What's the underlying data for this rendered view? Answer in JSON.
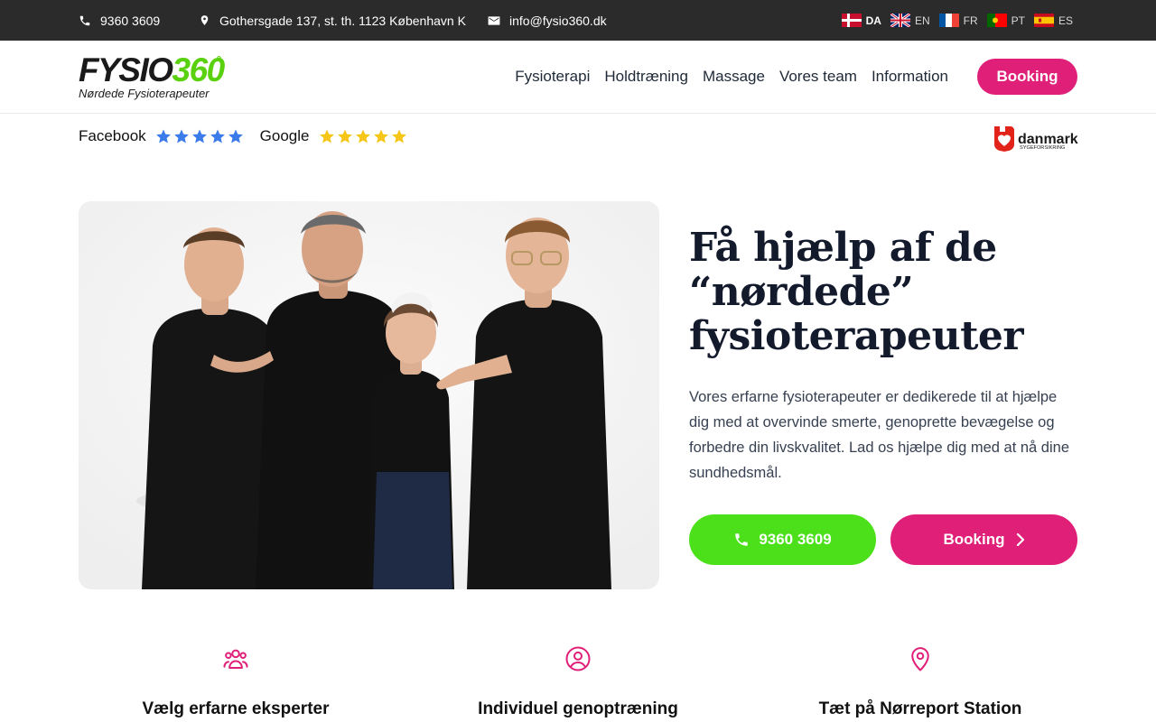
{
  "topbar": {
    "phone": "9360 3609",
    "address": "Gothersgade 137, st. th. 1123 København K",
    "email": "info@fysio360.dk",
    "languages": [
      {
        "code": "DA",
        "active": true
      },
      {
        "code": "EN",
        "active": false
      },
      {
        "code": "FR",
        "active": false
      },
      {
        "code": "PT",
        "active": false
      },
      {
        "code": "ES",
        "active": false
      }
    ]
  },
  "header": {
    "logo_fysio": "FYSIO",
    "logo_num": "360",
    "logo_deg": "°",
    "logo_tagline": "Nørdede Fysioterapeuter",
    "nav": [
      "Fysioterapi",
      "Holdtræning",
      "Massage",
      "Vores team",
      "Information"
    ],
    "booking_label": "Booking"
  },
  "reviews": {
    "facebook_label": "Facebook",
    "facebook_stars": 5,
    "google_label": "Google",
    "google_stars": 5,
    "partner_word": "danmark",
    "partner_sub": "SYGEFORSIKRING"
  },
  "hero": {
    "title_line1": " Få hjælp af de",
    "title_line2": "“nørdede”",
    "title_line3": "fysioterapeuter",
    "text": "Vores erfarne fysioterapeuter er dedikerede til at hjælpe dig med at overvinde smerte, genoprette bevægelse og forbedre din livskvalitet. Lad os hjælpe dig med at nå dine sundhedsmål.",
    "phone_label": "9360 3609",
    "booking_label": "Booking"
  },
  "features": [
    {
      "title": "Vælg erfarne eksperter",
      "icon": "group-icon"
    },
    {
      "title": "Individuel genoptræning",
      "icon": "user-circle-icon"
    },
    {
      "title": "Tæt på Nørreport Station",
      "icon": "map-pin-icon"
    }
  ],
  "colors": {
    "accent_pink": "#e01f78",
    "accent_green": "#4be01a",
    "topbar_bg": "#2b2b2b",
    "star_facebook": "#3b7bea",
    "star_google": "#f5c518"
  }
}
